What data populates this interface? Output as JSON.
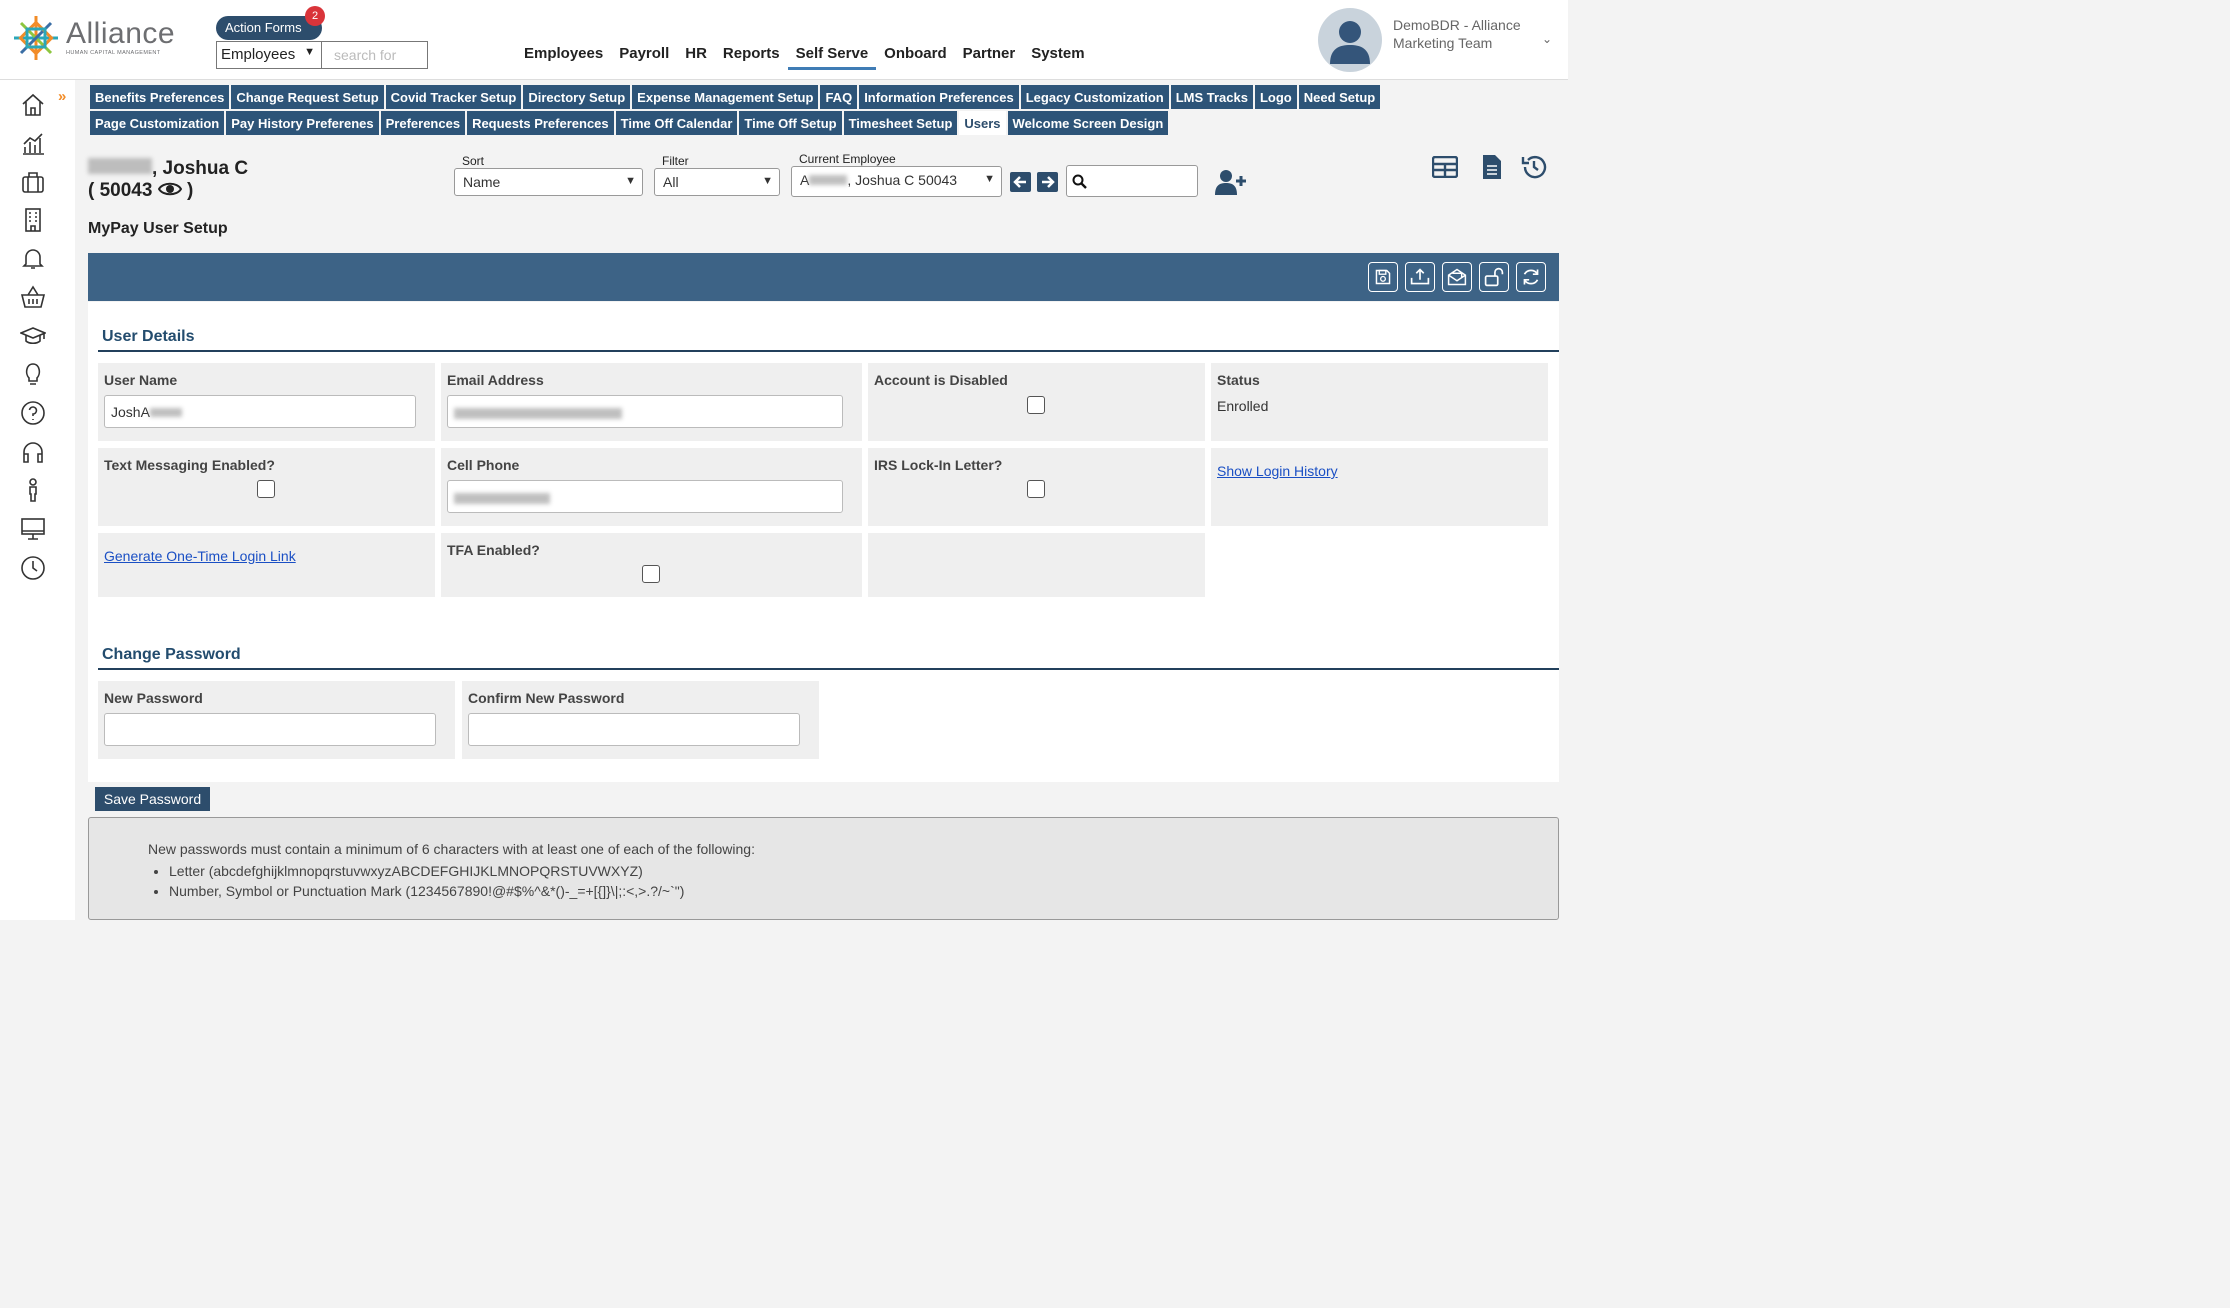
{
  "brand": {
    "name": "Alliance",
    "tagline": "HUMAN CAPITAL MANAGEMENT"
  },
  "action_forms": {
    "label": "Action Forms",
    "badge": "2"
  },
  "quick_search": {
    "scope": "Employees",
    "placeholder": "search for"
  },
  "main_nav": [
    {
      "label": "Employees"
    },
    {
      "label": "Payroll"
    },
    {
      "label": "HR"
    },
    {
      "label": "Reports"
    },
    {
      "label": "Self Serve",
      "active": true
    },
    {
      "label": "Onboard"
    },
    {
      "label": "Partner"
    },
    {
      "label": "System"
    }
  ],
  "user": {
    "name_line1": "DemoBDR - Alliance",
    "name_line2": "Marketing Team"
  },
  "sidebar_icons": [
    "home-icon",
    "analytics-icon",
    "briefcase-icon",
    "building-icon",
    "bell-icon",
    "basket-icon",
    "graduation-cap-icon",
    "lightbulb-icon",
    "help-icon",
    "headset-icon",
    "person-icon",
    "monitor-icon",
    "clock-icon"
  ],
  "tabs_row1": [
    "Benefits Preferences",
    "Change Request Setup",
    "Covid Tracker Setup",
    "Directory Setup",
    "Expense Management Setup",
    "FAQ",
    "Information Preferences",
    "Legacy Customization",
    "LMS Tracks",
    "Logo",
    "Need Setup"
  ],
  "tabs_row2": [
    "Page Customization",
    "Pay History Preferenes",
    "Preferences",
    "Requests Preferences",
    "Time Off Calendar",
    "Time Off Setup",
    "Timesheet Setup",
    "Users",
    "Welcome Screen Design"
  ],
  "selected_tab": "Users",
  "employee": {
    "name_suffix": ", Joshua C",
    "id_line": "( 50043"
  },
  "sort": {
    "label": "Sort",
    "value": "Name"
  },
  "filter": {
    "label": "Filter",
    "value": "All"
  },
  "current_employee": {
    "label": "Current Employee",
    "prefix": "A",
    "value": ", Joshua C 50043"
  },
  "page_title": "MyPay User Setup",
  "user_details": {
    "title": "User Details",
    "user_name_label": "User Name",
    "user_name_value": "JoshA",
    "email_label": "Email Address",
    "account_disabled_label": "Account is Disabled",
    "status_label": "Status",
    "status_value": "Enrolled",
    "text_messaging_label": "Text Messaging Enabled?",
    "cell_phone_label": "Cell Phone",
    "irs_label": "IRS Lock-In Letter?",
    "login_history_link": "Show Login History",
    "one_time_link": "Generate One-Time Login Link",
    "tfa_label": "TFA Enabled?"
  },
  "change_password": {
    "title": "Change Password",
    "new_label": "New Password",
    "confirm_label": "Confirm New Password",
    "save_label": "Save Password",
    "rules_intro": "New passwords must contain a minimum of 6 characters with at least one of each of the following:",
    "rule1": "Letter (abcdefghijklmnopqrstuvwxyzABCDEFGHIJKLMNOPQRSTUVWXYZ)",
    "rule2": "Number, Symbol or Punctuation Mark (1234567890!@#$%^&*()-_=+[{]}\\|;:<,>.?/~`\")"
  },
  "colors": {
    "nav_blue": "#2d5478",
    "toolbar_blue": "#3d6386",
    "accent_orange": "#f28c28",
    "badge_red": "#d9343a"
  }
}
